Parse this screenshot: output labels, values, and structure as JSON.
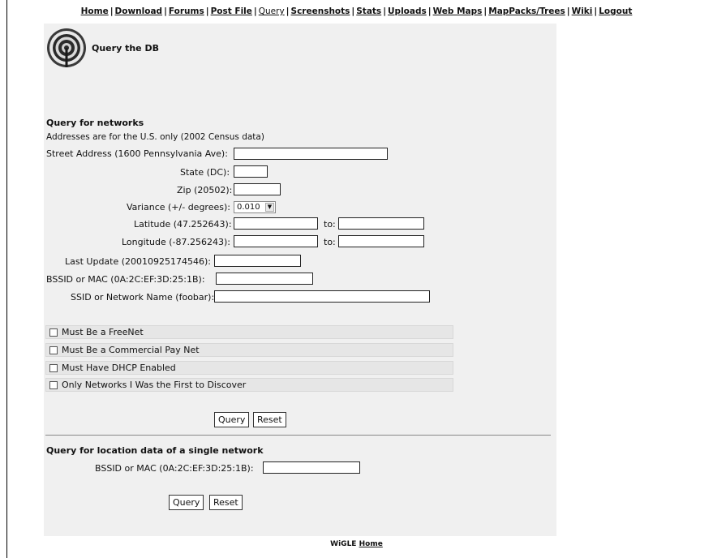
{
  "nav": [
    {
      "label": "Home"
    },
    {
      "label": "Download"
    },
    {
      "label": "Forums"
    },
    {
      "label": "Post File"
    },
    {
      "label": "Query"
    },
    {
      "label": "Screenshots"
    },
    {
      "label": "Stats"
    },
    {
      "label": "Uploads"
    },
    {
      "label": "Web Maps"
    },
    {
      "label": "MapPacks/Trees"
    },
    {
      "label": "Wiki"
    },
    {
      "label": "Logout"
    }
  ],
  "page_title": "Query the DB",
  "networks": {
    "title": "Query for networks",
    "note": "Addresses are for the U.S. only (2002 Census data)",
    "street_label": "Street Address (1600 Pennsylvania Ave):",
    "state_label": "State (DC):",
    "zip_label": "Zip (20502):",
    "variance_label": "Variance (+/- degrees):",
    "variance_value": "0.010",
    "latitude_label": "Latitude (47.252643):",
    "longitude_label": "Longitude (-87.256243):",
    "to_label": "to:",
    "last_update_label": "Last Update (20010925174546):",
    "bssid_label": "BSSID or MAC (0A:2C:EF:3D:25:1B):",
    "ssid_label": "SSID or Network Name (foobar):",
    "checkboxes": [
      {
        "label": "Must Be a FreeNet"
      },
      {
        "label": "Must Be a Commercial Pay Net"
      },
      {
        "label": "Must Have DHCP Enabled"
      },
      {
        "label": "Only Networks I Was the First to Discover"
      }
    ],
    "query_button": "Query",
    "reset_button": "Reset"
  },
  "single": {
    "title": "Query for location data of a single network",
    "bssid_label": "BSSID or MAC (0A:2C:EF:3D:25:1B):",
    "query_button": "Query",
    "reset_button": "Reset"
  },
  "footer": {
    "brand": "WiGLE",
    "home": "Home"
  }
}
